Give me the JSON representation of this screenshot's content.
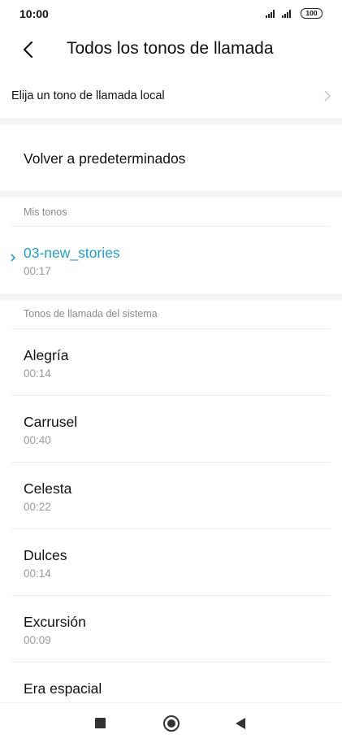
{
  "status_bar": {
    "time": "10:00",
    "battery": "100"
  },
  "header": {
    "title": "Todos los tonos de llamada",
    "back_icon": "chevron-left-icon"
  },
  "local_ringtone": {
    "label": "Elija un tono de llamada local",
    "chevron_icon": "chevron-right-icon"
  },
  "restore_default": {
    "label": "Volver a predeterminados"
  },
  "my_tones": {
    "section_label": "Mis tonos",
    "items": [
      {
        "name": "03-new_stories",
        "duration": "00:17",
        "selected": true
      }
    ]
  },
  "system_tones": {
    "section_label": "Tonos de llamada del sistema",
    "items": [
      {
        "name": "Alegría",
        "duration": "00:14"
      },
      {
        "name": "Carrusel",
        "duration": "00:40"
      },
      {
        "name": "Celesta",
        "duration": "00:22"
      },
      {
        "name": "Dulces",
        "duration": "00:14"
      },
      {
        "name": "Excursión",
        "duration": "00:09"
      },
      {
        "name": "Era espacial",
        "duration": ""
      }
    ]
  },
  "nav_bar": {
    "recent_icon": "square-icon",
    "home_icon": "circle-icon",
    "back_icon": "triangle-back-icon"
  },
  "colors": {
    "accent": "#1fa0cf",
    "secondary_text": "#9a9a9a",
    "section_gap": "#f4f4f4"
  }
}
